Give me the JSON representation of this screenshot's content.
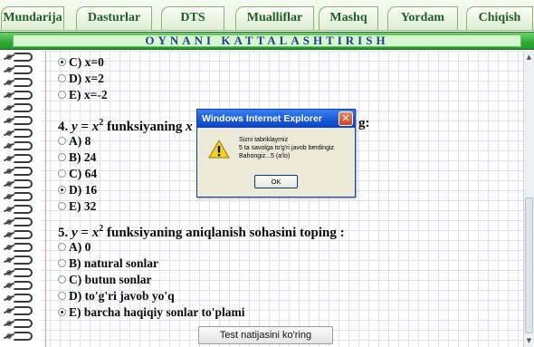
{
  "tabs": [
    {
      "label": "Mundarija"
    },
    {
      "label": "Dasturlar"
    },
    {
      "label": "DTS"
    },
    {
      "label": "Mualliflar"
    },
    {
      "label": "Mashq"
    },
    {
      "label": "Yordam"
    },
    {
      "label": "Chiqish"
    }
  ],
  "header": {
    "title": "OYNANI KATTALASHTIRISH"
  },
  "question3": {
    "options": [
      {
        "label": "C) x=0",
        "selected": true
      },
      {
        "label": "D) x=2",
        "selected": false
      },
      {
        "label": "E) x=-2",
        "selected": false
      }
    ]
  },
  "question4": {
    "prefix": "4. ",
    "var_y": "y",
    "eq": " = ",
    "var_x": "x",
    "exp": "2",
    "text_before_dialog": " funksiyaning ",
    "var_x2": "x",
    "text_after_dialog": "g:",
    "options": [
      {
        "label": "A) 8",
        "selected": false
      },
      {
        "label": "B) 24",
        "selected": false
      },
      {
        "label": "C) 64",
        "selected": false
      },
      {
        "label": "D) 16",
        "selected": true
      },
      {
        "label": "E) 32",
        "selected": false
      }
    ]
  },
  "question5": {
    "prefix": "5. ",
    "var_y": "y",
    "eq": " = ",
    "var_x": "x",
    "exp": "2",
    "text": " funksiyaning aniqlanish sohasini toping :",
    "options": [
      {
        "label": "A) 0",
        "selected": false
      },
      {
        "label": "B) natural sonlar",
        "selected": false
      },
      {
        "label": "C) butun sonlar",
        "selected": false
      },
      {
        "label": "D) to'g'ri javob yo'q",
        "selected": false
      },
      {
        "label": "E) barcha haqiqiy sonlar to'plami",
        "selected": true
      }
    ]
  },
  "test_button": {
    "label": "Test natijasini ko'ring"
  },
  "dialog": {
    "title": "Windows Internet Explorer",
    "close_label": "✕",
    "line1": "Sizni tabriklaymiz",
    "line2": "5 ta savolga to'g'ri javob berdingiz",
    "line3": "Bahongiz...5 (a'lo)",
    "ok_label": "OK",
    "icon": "warning-icon"
  },
  "scrollbar": {
    "up": "▲",
    "down": "▼"
  }
}
